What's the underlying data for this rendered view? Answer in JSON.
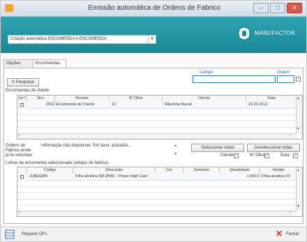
{
  "window": {
    "title": "Emissão automática de Ordens de Fabrico"
  },
  "header": {
    "combo_value": "Criação automática ENCOMENDA A ENCOMENDA",
    "brand": "MANUFACTOR"
  },
  "tabs": [
    {
      "label": "Opções gerais"
    },
    {
      "label": "Encomendas"
    }
  ],
  "search": {
    "button_label": "Pesquisar",
    "field_label": "Campo",
    "order_label": "Ordem"
  },
  "orders": {
    "section_label": "Encomendas de cliente",
    "columns": [
      "Inc?",
      "Ano",
      "Dossier",
      "Nº Obra",
      "Cliente",
      "Data"
    ],
    "rows": [
      {
        "inc": "",
        "ano": "2012",
        "dossier": "Encomenda de Cliente",
        "obra": "12",
        "cliente": "Albertina Maciel",
        "data": "16.03.2012"
      }
    ]
  },
  "included": {
    "label": "Ordens de Fabrico ainda já foi incluídas",
    "info": "Informação não disponível. Por favor, actualize...",
    "select_all": "Seleccionar todas",
    "deselect_all": "Deseleccionar todas",
    "filter_cliente": "Cliente",
    "filter_obra": "Nº Obra",
    "filter_data": "Data"
  },
  "lines": {
    "section_label": "Linhas da encomenda seleccionada (artigos de fabrico)",
    "columns": [
      "Código",
      "Descrição",
      "Cor",
      "Tamanho",
      "Quantidade",
      "Versão"
    ],
    "rows": [
      {
        "code": "JUBEGAN",
        "desc": "Filha alcalina M4 (PMC - Power High Cam",
        "cor": "",
        "tam": "",
        "qty": "1,000.0",
        "ver": "Filha alcalina UV"
      }
    ]
  },
  "footer": {
    "prepare": "Preparar OFs",
    "close": "Fechar"
  },
  "colors": {
    "header": "#1a8997",
    "accent": "#2b7fd1",
    "danger": "#d22222"
  }
}
